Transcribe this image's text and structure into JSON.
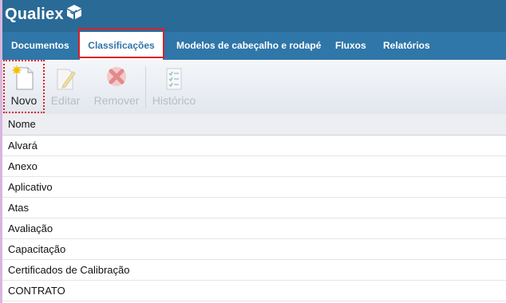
{
  "header": {
    "logo_text": "Qualiex"
  },
  "nav": {
    "tabs": [
      {
        "label": "Documentos"
      },
      {
        "label": "Classificações"
      },
      {
        "label": "Modelos de cabeçalho e rodapé"
      },
      {
        "label": "Fluxos"
      },
      {
        "label": "Relatórios"
      }
    ],
    "active_tab": "Classificações"
  },
  "toolbar": {
    "buttons": [
      {
        "label": "Novo",
        "icon": "new-document-icon",
        "enabled": true
      },
      {
        "label": "Editar",
        "icon": "edit-document-icon",
        "enabled": false
      },
      {
        "label": "Remover",
        "icon": "remove-x-icon",
        "enabled": false
      },
      {
        "label": "Histórico",
        "icon": "history-checklist-icon",
        "enabled": false
      }
    ]
  },
  "table": {
    "column_header": "Nome",
    "rows": [
      "Alvará",
      "Anexo",
      "Aplicativo",
      "Atas",
      "Avaliação",
      "Capacitação",
      "Certificados de Calibração",
      "CONTRATO"
    ]
  },
  "colors": {
    "header_bg": "#2a6a96",
    "nav_bg": "#2f76a9",
    "highlight": "#d9222a"
  }
}
